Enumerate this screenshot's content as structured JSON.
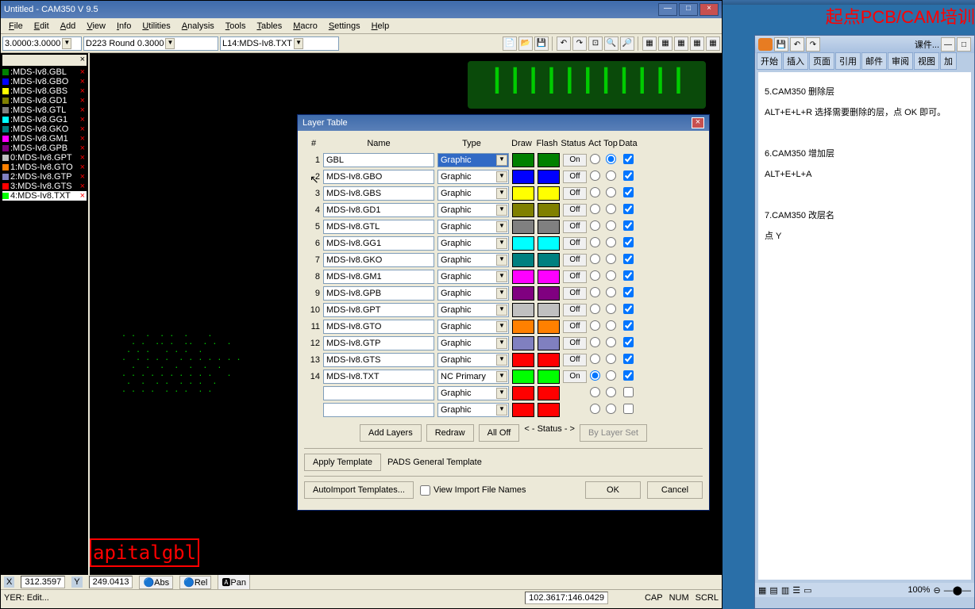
{
  "app": {
    "title": "Untitled - CAM350 V 9.5",
    "menus": [
      "File",
      "Edit",
      "Add",
      "View",
      "Info",
      "Utilities",
      "Analysis",
      "Tools",
      "Tables",
      "Macro",
      "Settings",
      "Help"
    ],
    "combo_zoom": "3.0000:3.0000",
    "combo_aperture": "D223  Round 0.3000",
    "combo_layer": "L14:MDS-Iv8.TXT"
  },
  "layer_panel": {
    "items": [
      {
        "name": ":MDS-Iv8.GBL",
        "sq": "#008000"
      },
      {
        "name": ":MDS-Iv8.GBO",
        "sq": "#0000ff"
      },
      {
        "name": ":MDS-Iv8.GBS",
        "sq": "#ffff00"
      },
      {
        "name": ":MDS-Iv8.GD1",
        "sq": "#808000"
      },
      {
        "name": ":MDS-Iv8.GTL",
        "sq": "#808080"
      },
      {
        "name": ":MDS-Iv8.GG1",
        "sq": "#00ffff"
      },
      {
        "name": ":MDS-Iv8.GKO",
        "sq": "#008080"
      },
      {
        "name": ":MDS-Iv8.GM1",
        "sq": "#ff00ff"
      },
      {
        "name": ":MDS-Iv8.GPB",
        "sq": "#800080"
      },
      {
        "name": "0:MDS-Iv8.GPT",
        "sq": "#c0c0c0"
      },
      {
        "name": "1:MDS-Iv8.GTO",
        "sq": "#ff8000"
      },
      {
        "name": "2:MDS-Iv8.GTP",
        "sq": "#8080c0"
      },
      {
        "name": "3:MDS-Iv8.GTS",
        "sq": "#ff0000"
      }
    ],
    "active": {
      "name": "4:MDS-Iv8.TXT",
      "sq": "#00ff00"
    }
  },
  "layer_table": {
    "title": "Layer Table",
    "headers": {
      "num": "#",
      "name": "Name",
      "type": "Type",
      "draw": "Draw",
      "flash": "Flash",
      "status": "Status",
      "act": "Act",
      "top": "Top",
      "data": "Data"
    },
    "rows": [
      {
        "n": 1,
        "name": "GBL",
        "type": "Graphic",
        "type_sel": true,
        "draw": "#008000",
        "flash": "#008000",
        "status": "On",
        "act": false,
        "top": true,
        "data": true
      },
      {
        "n": 2,
        "name": "MDS-Iv8.GBO",
        "type": "Graphic",
        "draw": "#0000ff",
        "flash": "#0000ff",
        "status": "Off",
        "act": false,
        "top": false,
        "data": true
      },
      {
        "n": 3,
        "name": "MDS-Iv8.GBS",
        "type": "Graphic",
        "draw": "#ffff00",
        "flash": "#ffff00",
        "status": "Off",
        "act": false,
        "top": false,
        "data": true
      },
      {
        "n": 4,
        "name": "MDS-Iv8.GD1",
        "type": "Graphic",
        "draw": "#808000",
        "flash": "#808000",
        "status": "Off",
        "act": false,
        "top": false,
        "data": true
      },
      {
        "n": 5,
        "name": "MDS-Iv8.GTL",
        "type": "Graphic",
        "draw": "#808080",
        "flash": "#808080",
        "status": "Off",
        "act": false,
        "top": false,
        "data": true
      },
      {
        "n": 6,
        "name": "MDS-Iv8.GG1",
        "type": "Graphic",
        "draw": "#00ffff",
        "flash": "#00ffff",
        "status": "Off",
        "act": false,
        "top": false,
        "data": true
      },
      {
        "n": 7,
        "name": "MDS-Iv8.GKO",
        "type": "Graphic",
        "draw": "#008080",
        "flash": "#008080",
        "status": "Off",
        "act": false,
        "top": false,
        "data": true
      },
      {
        "n": 8,
        "name": "MDS-Iv8.GM1",
        "type": "Graphic",
        "draw": "#ff00ff",
        "flash": "#ff00ff",
        "status": "Off",
        "act": false,
        "top": false,
        "data": true
      },
      {
        "n": 9,
        "name": "MDS-Iv8.GPB",
        "type": "Graphic",
        "draw": "#800080",
        "flash": "#800080",
        "status": "Off",
        "act": false,
        "top": false,
        "data": true
      },
      {
        "n": 10,
        "name": "MDS-Iv8.GPT",
        "type": "Graphic",
        "draw": "#c0c0c0",
        "flash": "#c0c0c0",
        "status": "Off",
        "act": false,
        "top": false,
        "data": true
      },
      {
        "n": 11,
        "name": "MDS-Iv8.GTO",
        "type": "Graphic",
        "draw": "#ff8000",
        "flash": "#ff8000",
        "status": "Off",
        "act": false,
        "top": false,
        "data": true
      },
      {
        "n": 12,
        "name": "MDS-Iv8.GTP",
        "type": "Graphic",
        "draw": "#8080c0",
        "flash": "#8080c0",
        "status": "Off",
        "act": false,
        "top": false,
        "data": true
      },
      {
        "n": 13,
        "name": "MDS-Iv8.GTS",
        "type": "Graphic",
        "draw": "#ff0000",
        "flash": "#ff0000",
        "status": "Off",
        "act": false,
        "top": false,
        "data": true
      },
      {
        "n": 14,
        "name": "MDS-Iv8.TXT",
        "type": "NC Primary",
        "draw": "#00ff00",
        "flash": "#00ff00",
        "status": "On",
        "act": true,
        "top": false,
        "data": true
      },
      {
        "n": "",
        "name": "",
        "type": "Graphic",
        "draw": "#ff0000",
        "flash": "#ff0000",
        "status": "",
        "act": false,
        "top": false,
        "data": false,
        "blank": true
      },
      {
        "n": "",
        "name": "",
        "type": "Graphic",
        "draw": "#ff0000",
        "flash": "#ff0000",
        "status": "",
        "act": false,
        "top": false,
        "data": false,
        "blank": true
      }
    ],
    "buttons": {
      "add": "Add Layers",
      "redraw": "Redraw",
      "alloff": "All Off",
      "status": "< - Status - >",
      "bylayer": "By Layer Set"
    },
    "apply_template": "Apply Template",
    "pads_template": "PADS General Template",
    "autoimport": "AutoImport Templates...",
    "view_import": "View Import File Names",
    "ok": "OK",
    "cancel": "Cancel"
  },
  "status": {
    "x_label": "X",
    "x": "312.3597",
    "y_label": "Y",
    "y": "249.0413",
    "abs": "Abs",
    "rel": "Rel",
    "pan": "Pan",
    "layer_msg": "YER: Edit...",
    "coords": "102.3617:146.0429",
    "cap": "CAP",
    "num": "NUM",
    "scrl": "SCRL"
  },
  "red_label": "apitalgbl",
  "red_header": "起点PCB/CAM培训",
  "word": {
    "title": "课件...",
    "tabs": [
      "开始",
      "插入",
      "页面",
      "引用",
      "邮件",
      "审阅",
      "视图",
      "加"
    ],
    "content": [
      "5.CAM350 删除层",
      "  ALT+E+L+R 选择需要删除的层，点 OK 即可。",
      "",
      "6.CAM350 增加层",
      "    ALT+E+L+A",
      "",
      "7.CAM350 改层名",
      "  点 Y"
    ],
    "zoom": "100%"
  }
}
